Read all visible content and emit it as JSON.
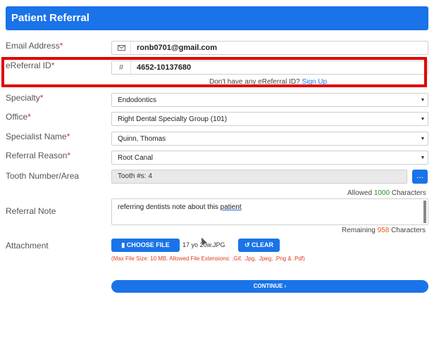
{
  "header": {
    "title": "Patient Referral"
  },
  "email": {
    "label": "Email Address",
    "required": "*",
    "icon": "envelope-icon",
    "value": "ronb0701@gmail.com"
  },
  "ereferral": {
    "label": "eReferral ID",
    "required": "*",
    "icon": "hash-icon",
    "value": "4652-10137680",
    "hint": "Don't have any eReferral ID?",
    "signup": "Sign Up"
  },
  "specialty": {
    "label": "Specialty",
    "required": "*",
    "value": "Endodontics"
  },
  "office": {
    "label": "Office",
    "required": "*",
    "value": "Right Dental Specialty Group (101)"
  },
  "specialist": {
    "label": "Specialist Name",
    "required": "*",
    "value": "Quinn, Thomas"
  },
  "reason": {
    "label": "Referral Reason",
    "required": "*",
    "value": "Root Canal"
  },
  "tooth": {
    "label": "Tooth Number/Area",
    "value": "Tooth #s: 4",
    "button": "..."
  },
  "allowed": {
    "prefix": "Allowed",
    "count": "1000",
    "suffix": "Characters"
  },
  "note": {
    "label": "Referral Note",
    "text": "referring dentists note about this ",
    "text_underlined": "patient"
  },
  "remaining": {
    "prefix": "Remaining",
    "count": "958",
    "suffix": "Characters"
  },
  "attachment": {
    "label": "Attachment",
    "choose": "CHOOSE FILE",
    "filename": "17 yo 20w.JPG",
    "clear": "CLEAR",
    "constraints": "(Max File Size: 10 MB. Allowed File Extensions: .Gif, .Jpg, .Jpeg, .Png & .Pdf)"
  },
  "actions": {
    "continue": "CONTINUE ›"
  },
  "colors": {
    "primary": "#1a73e8",
    "highlight": "#e00000",
    "allowed": "#2e8b2e",
    "remaining": "#e65a1a"
  }
}
